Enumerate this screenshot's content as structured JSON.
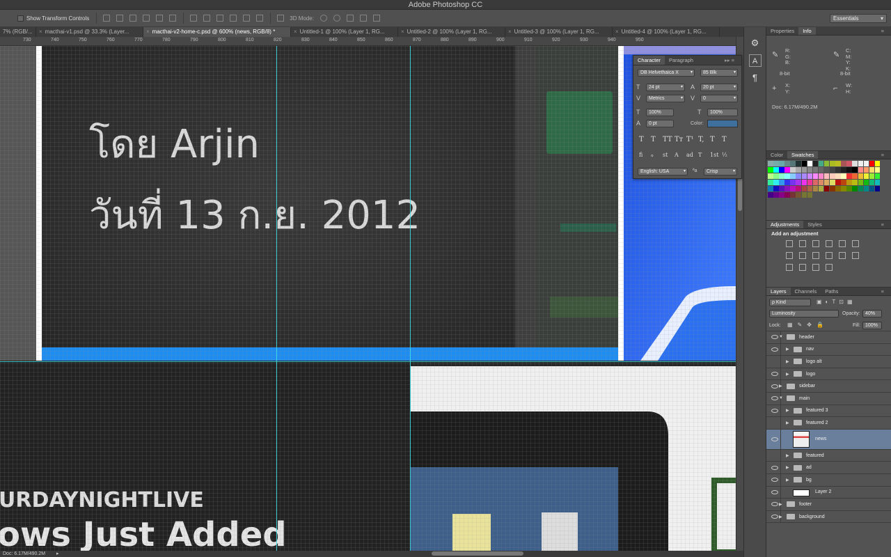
{
  "app": {
    "title": "Adobe Photoshop CC"
  },
  "options": {
    "show_transform": "Show Transform Controls",
    "mode3d": "3D Mode:",
    "workspace": "Essentials"
  },
  "tabs": [
    {
      "label": "7% (RGB/...",
      "close": "×"
    },
    {
      "label": "macthai-v1.psd @ 33.3% (Layer...",
      "close": "×"
    },
    {
      "label": "macthai-v2-home-c.psd @ 600% (news, RGB/8) *",
      "close": "×",
      "active": true
    },
    {
      "label": "Untitled-1 @ 100% (Layer 1, RG...",
      "close": "×"
    },
    {
      "label": "Untitled-2 @ 100% (Layer 1, RG...",
      "close": "×"
    },
    {
      "label": "Untitled-3 @ 100% (Layer 1, RG...",
      "close": "×"
    },
    {
      "label": "Untitled-4 @ 100% (Layer 1, RG...",
      "close": "×"
    }
  ],
  "ruler": [
    "730",
    "740",
    "750",
    "760",
    "770",
    "780",
    "790",
    "800",
    "810",
    "820",
    "830",
    "840",
    "850",
    "860",
    "870",
    "880",
    "890",
    "900",
    "910",
    "920",
    "930",
    "940",
    "950"
  ],
  "canvas": {
    "author": "โดย Arjin",
    "date": "วันที่ 13 ก.ย. 2012",
    "snl": "URDAYNIGHTLIVE",
    "snl2": "ows Just Added",
    "b_letter": "B"
  },
  "status": {
    "doc": "Doc: 6.17M/490.2M"
  },
  "character": {
    "tabs": [
      "Character",
      "Paragraph"
    ],
    "font": "DB Helvethaica X",
    "style": "85 Blk",
    "size": "24 pt",
    "leading": "20 pt",
    "kerning": "Metrics",
    "tracking": "0",
    "vscale": "100%",
    "hscale": "100%",
    "baseline": "0 pt",
    "color_label": "Color:",
    "color": "#3f6f9c",
    "lang": "English: USA",
    "aa": "Crisp",
    "aa_icon": "aa",
    "style_glyphs": [
      "T",
      "T",
      "TT",
      "Tт",
      "T¹",
      "T,",
      "T",
      "T"
    ],
    "ot_glyphs": [
      "fi",
      "ℴ",
      "st",
      "A",
      "ad",
      "T",
      "1st",
      "½"
    ]
  },
  "info": {
    "tabs": [
      "Properties",
      "Info"
    ],
    "rgb": "R:\nG:\nB:",
    "cmyk": "C:\nM:\nY:\nK:",
    "bit1": "8-bit",
    "bit2": "8-bit",
    "xy": "X:\nY:",
    "wh": "W:\nH:",
    "doc": "Doc: 6.17M/490.2M"
  },
  "color_panel": {
    "tabs": [
      "Color",
      "Swatches"
    ]
  },
  "adjustments": {
    "tabs": [
      "Adjustments",
      "Styles"
    ],
    "label": "Add an adjustment"
  },
  "layers_panel": {
    "tabs": [
      "Layers",
      "Channels",
      "Paths"
    ],
    "kind": "ρ Kind",
    "blend": "Luminosity",
    "opacity_label": "Opacity:",
    "opacity": "40%",
    "lock_label": "Lock:",
    "fill_label": "Fill:",
    "fill": "100%",
    "rows": [
      {
        "name": "header",
        "indent": 0,
        "open": true,
        "vis": true
      },
      {
        "name": "nav",
        "indent": 1,
        "vis": true
      },
      {
        "name": "logo alt",
        "indent": 1,
        "vis": false
      },
      {
        "name": "logo",
        "indent": 1,
        "vis": true
      },
      {
        "name": "sidebar",
        "indent": 0,
        "vis": true
      },
      {
        "name": "main",
        "indent": 0,
        "open": true,
        "vis": true
      },
      {
        "name": "featured 3",
        "indent": 1,
        "vis": true
      },
      {
        "name": "featured 2",
        "indent": 1,
        "vis": false
      },
      {
        "name": "news",
        "indent": 1,
        "vis": true,
        "selected": true,
        "thumb": true
      },
      {
        "name": "featured",
        "indent": 1,
        "vis": false
      },
      {
        "name": "ad",
        "indent": 1,
        "vis": true
      },
      {
        "name": "bg",
        "indent": 1,
        "vis": true
      },
      {
        "name": "Layer 2",
        "indent": 0,
        "vis": true,
        "white": true
      },
      {
        "name": "footer",
        "indent": 0,
        "vis": true
      },
      {
        "name": "background",
        "indent": 0,
        "vis": true
      }
    ]
  },
  "swatch_colors": [
    "#8aa",
    "#7aa",
    "#6aa",
    "#688",
    "#577",
    "#233",
    "#000",
    "#fff",
    "#222",
    "#4a8",
    "#8b3",
    "#ab2",
    "#bb2",
    "#a55",
    "#c56",
    "#ddd",
    "#eee",
    "#f1f1f1",
    "#f00",
    "#ff0",
    "#0f0",
    "#0ff",
    "#00f",
    "#f0f",
    "#ccc",
    "#aaa",
    "#999",
    "#888",
    "#777",
    "#666",
    "#555",
    "#444",
    "#333",
    "#222",
    "#111",
    "#000",
    "#f88",
    "#f96",
    "#fd6",
    "#ff8",
    "#bf8",
    "#8f8",
    "#8fc",
    "#8ff",
    "#8cf",
    "#88f",
    "#a8f",
    "#c8f",
    "#f8f",
    "#f8c",
    "#fbb",
    "#fcb",
    "#fdb",
    "#ffb",
    "#e33",
    "#e63",
    "#eb3",
    "#ee3",
    "#9e3",
    "#3e3",
    "#3e9",
    "#3ee",
    "#39e",
    "#33e",
    "#73e",
    "#a3e",
    "#e3e",
    "#e39",
    "#d66",
    "#d86",
    "#da6",
    "#dd6",
    "#b11",
    "#b41",
    "#b91",
    "#bb1",
    "#7b1",
    "#1b1",
    "#1b7",
    "#1bb",
    "#17b",
    "#11b",
    "#51b",
    "#81b",
    "#b1b",
    "#b17",
    "#a44",
    "#a64",
    "#a84",
    "#aa4",
    "#800",
    "#830",
    "#860",
    "#880",
    "#580",
    "#080",
    "#085",
    "#088",
    "#058",
    "#008",
    "#408",
    "#608",
    "#808",
    "#805",
    "#733",
    "#753",
    "#773",
    "#773"
  ]
}
